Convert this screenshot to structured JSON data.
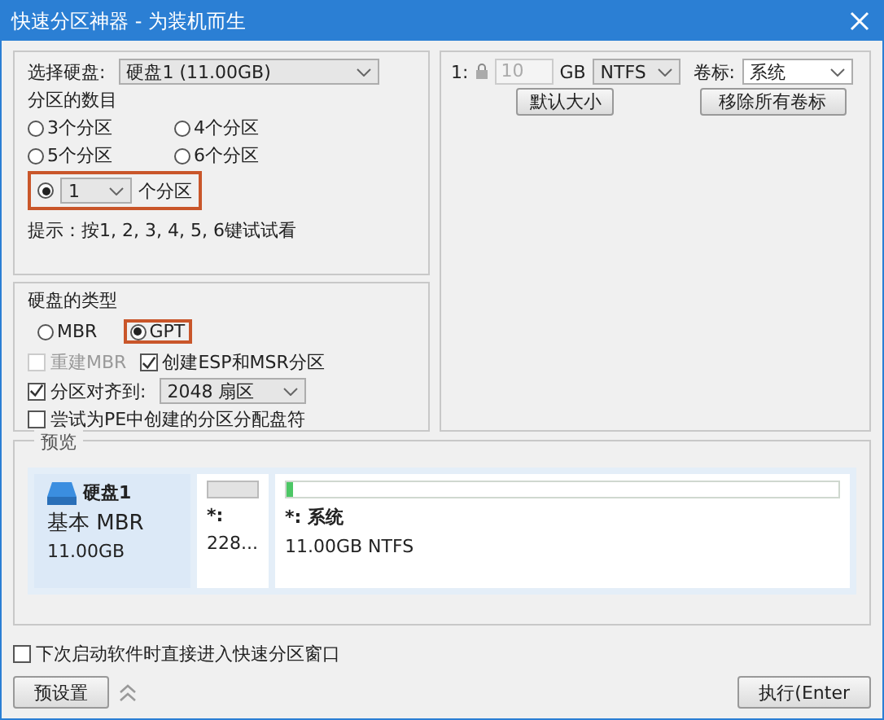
{
  "window": {
    "title": "快速分区神器 - 为装机而生"
  },
  "disk_select": {
    "label": "选择硬盘:",
    "value": "硬盘1 (11.00GB)"
  },
  "partition_count": {
    "label": "分区的数目",
    "options": [
      {
        "label": "3个分区",
        "selected": false
      },
      {
        "label": "4个分区",
        "selected": false
      },
      {
        "label": "5个分区",
        "selected": false
      },
      {
        "label": "6个分区",
        "selected": false
      }
    ],
    "custom": {
      "selected": true,
      "highlighted": true,
      "value": "1",
      "suffix": "个分区"
    },
    "hint": "提示：按1, 2, 3, 4, 5, 6键试试看"
  },
  "disk_type": {
    "label": "硬盘的类型",
    "options": [
      {
        "label": "MBR",
        "selected": false,
        "highlighted": false
      },
      {
        "label": "GPT",
        "selected": true,
        "highlighted": true
      }
    ],
    "checks": [
      {
        "label": "重建MBR",
        "checked": false,
        "disabled": true
      },
      {
        "label": "创建ESP和MSR分区",
        "checked": true,
        "disabled": false
      }
    ],
    "align": {
      "label": "分区对齐到:",
      "checked": true,
      "value": "2048 扇区"
    },
    "assign": {
      "label": "尝试为PE中创建的分区分配盘符",
      "checked": false
    }
  },
  "partition_row": {
    "index": "1:",
    "size": "10",
    "unit": "GB",
    "fs": "NTFS",
    "volume_caption": "卷标:",
    "volume_label": "系统",
    "default_button": "默认大小",
    "remove_button": "移除所有卷标"
  },
  "preview": {
    "title": "预览",
    "disk": {
      "name": "硬盘1",
      "type": "基本 MBR",
      "size": "11.00GB"
    },
    "partitions": [
      {
        "kind": "reserved",
        "name": "*:",
        "info": "228..."
      },
      {
        "kind": "volume",
        "name": "*: 系统",
        "info": "11.00GB NTFS",
        "level": 0.012
      }
    ]
  },
  "footer": {
    "startup": {
      "label": "下次启动软件时直接进入快速分区窗口",
      "checked": false
    },
    "preset_button": "预设置",
    "execute_button": "执行(Enter"
  }
}
